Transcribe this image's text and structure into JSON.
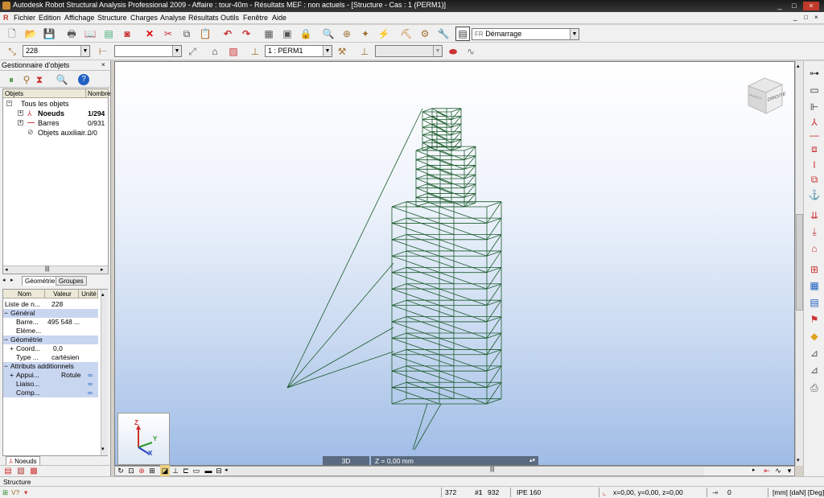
{
  "window": {
    "title": "Autodesk Robot Structural Analysis Professional 2009 - Affaire : tour-40m - Résultats MEF : non actuels - [Structure - Cas : 1 (PERM1)]",
    "controls": [
      "_",
      "□",
      "×"
    ]
  },
  "menu": [
    "Fichier",
    "Edition",
    "Affichage",
    "Structure",
    "Charges",
    "Analyse",
    "Résultats",
    "Outils",
    "Fenêtre",
    "Aide"
  ],
  "toolbar1": {
    "layout_combo": "Démarrage",
    "layout_prefix": "FR"
  },
  "toolbar2": {
    "selection_value": "228",
    "case_combo": "1 : PERM1"
  },
  "object_inspector": {
    "title": "Gestionnaire d'objets",
    "columns": [
      "Objets",
      "Nombre"
    ],
    "tree": [
      {
        "label": "Tous les objets",
        "value": ""
      },
      {
        "label": "Noeuds",
        "value": "1/294"
      },
      {
        "label": "Barres",
        "value": "0/931"
      },
      {
        "label": "Objets auxiliair...",
        "value": "0/0"
      }
    ],
    "tabs": [
      "Géométrie",
      "Groupes"
    ]
  },
  "properties": {
    "columns": [
      "Nom",
      "Valeur",
      "Unité"
    ],
    "rows": [
      {
        "type": "row",
        "name": "Liste de n...",
        "value": "228",
        "unit": ""
      },
      {
        "type": "section",
        "name": "Général"
      },
      {
        "type": "row",
        "name": "Barre...",
        "value": "495 548 ...",
        "unit": ""
      },
      {
        "type": "row",
        "name": "Eléme...",
        "value": "",
        "unit": ""
      },
      {
        "type": "section",
        "name": "Géométrie"
      },
      {
        "type": "row",
        "name": "Coord...",
        "value": "0,0",
        "unit": ""
      },
      {
        "type": "row",
        "name": "Type ...",
        "value": "cartésien",
        "unit": ""
      },
      {
        "type": "section",
        "name": "Attributs additionnels"
      },
      {
        "type": "row",
        "name": "Appui...",
        "value": "Rotule",
        "unit": ""
      },
      {
        "type": "row",
        "name": "Liaiso...",
        "value": "",
        "unit": ""
      },
      {
        "type": "row",
        "name": "Comp...",
        "value": "",
        "unit": ""
      }
    ],
    "bottom_tab": "Noeuds"
  },
  "viewport": {
    "view_label": "3D",
    "z_label": "Z = 0,00 mm",
    "viewcube_face": "DROITE",
    "viewcube_top": "AVANT",
    "axes": {
      "x": "X",
      "y": "Y",
      "z": "Z"
    },
    "structure_color": "#1a5a2a",
    "background_top": "#ffffff",
    "background_bottom": "#9fbce6"
  },
  "status": {
    "mode": "Structure",
    "node_count": "372",
    "bar_count": "932",
    "section": "IPE 160",
    "coords": "x=0,00, y=0,00, z=0,00",
    "value": "0",
    "units": "[mm] [daN] [Deg]"
  }
}
